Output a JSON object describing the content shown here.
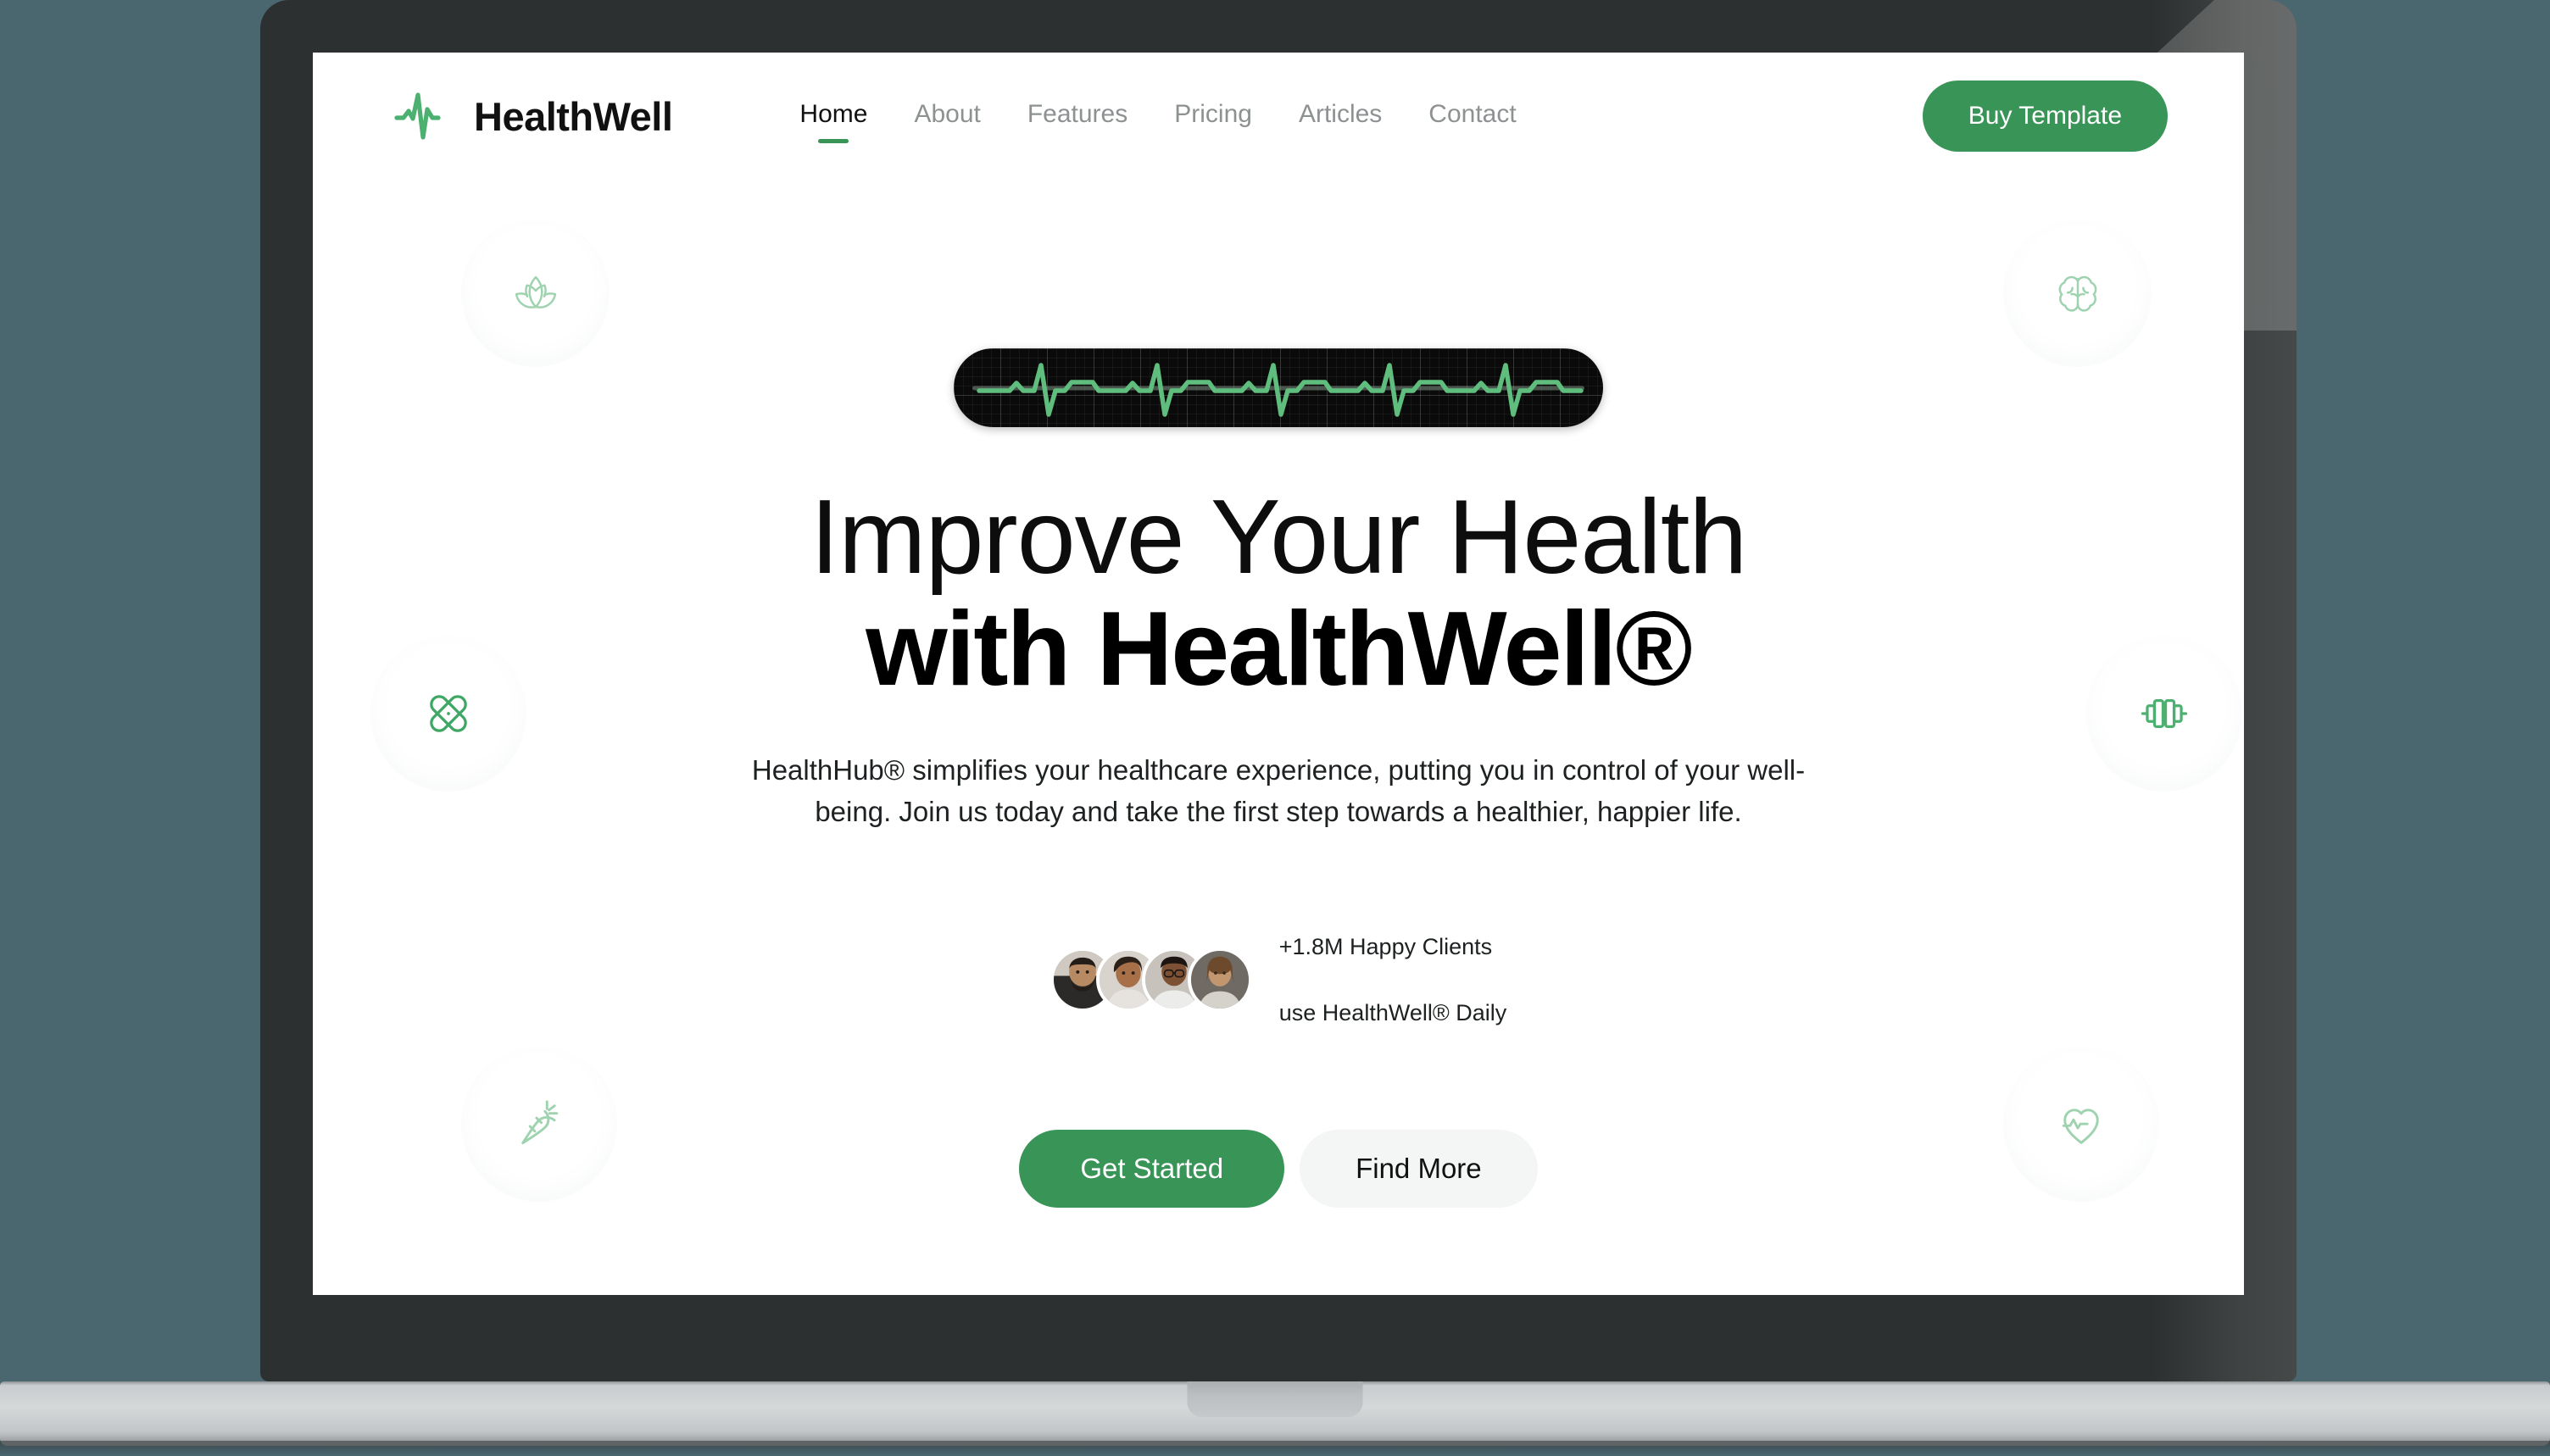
{
  "theme": {
    "page_background": "#4a6770",
    "accent_green": "#389457",
    "soft_green": "#9fd3b0",
    "device_body": "#2d3030",
    "device_base": "#d5d8d9",
    "screen_background": "#ffffff",
    "text_primary": "#111111",
    "text_muted": "#8d9192",
    "light_button_bg": "#f4f5f5"
  },
  "header": {
    "brand": {
      "name": "HealthWell",
      "logo_icon": "pulse-wave-icon"
    },
    "nav": [
      {
        "label": "Home",
        "active": true
      },
      {
        "label": "About",
        "active": false
      },
      {
        "label": "Features",
        "active": false
      },
      {
        "label": "Pricing",
        "active": false
      },
      {
        "label": "Articles",
        "active": false
      },
      {
        "label": "Contact",
        "active": false
      }
    ],
    "cta": {
      "label": "Buy Template"
    }
  },
  "hero": {
    "ecg": {
      "icon": "ecg-heartbeat-monitor-icon",
      "trace_color": "#5fbd7e",
      "screen_color": "#0a0a0a"
    },
    "headline_line1": "Improve Your Health",
    "headline_line2": "with HealthWell®",
    "subtitle": "HealthHub® simplifies your healthcare experience, putting you in control of your well-being. Join us today and take the first step towards a healthier, happier life.",
    "social_proof": {
      "line1": "+1.8M Happy Clients",
      "line2": "use HealthWell® Daily",
      "avatars": [
        {
          "name": "avatar-client-1",
          "skin": "#b78a64",
          "hair": "#241c17",
          "clothes": "#2b2a28",
          "bg": "#cfc9c2"
        },
        {
          "name": "avatar-client-2",
          "skin": "#a87049",
          "hair": "#2c2119",
          "clothes": "#e6e3de",
          "bg": "#d8d4cd"
        },
        {
          "name": "avatar-client-3",
          "skin": "#7d5134",
          "hair": "#1c1512",
          "clothes": "#ececea",
          "bg": "#c7c3bc"
        },
        {
          "name": "avatar-client-4",
          "skin": "#c29770",
          "hair": "#6e4a2d",
          "clothes": "#d5d2cc",
          "bg": "#6f6a64"
        }
      ]
    },
    "buttons": {
      "primary": "Get Started",
      "secondary": "Find More"
    },
    "decor_icons": [
      {
        "name": "lotus-icon",
        "position": "top-left"
      },
      {
        "name": "brain-icon",
        "position": "top-right"
      },
      {
        "name": "bandage-cross-icon",
        "position": "middle-left"
      },
      {
        "name": "dumbbell-icon",
        "position": "middle-right"
      },
      {
        "name": "carrot-icon",
        "position": "bottom-left"
      },
      {
        "name": "heart-pulse-icon",
        "position": "bottom-right"
      }
    ]
  }
}
